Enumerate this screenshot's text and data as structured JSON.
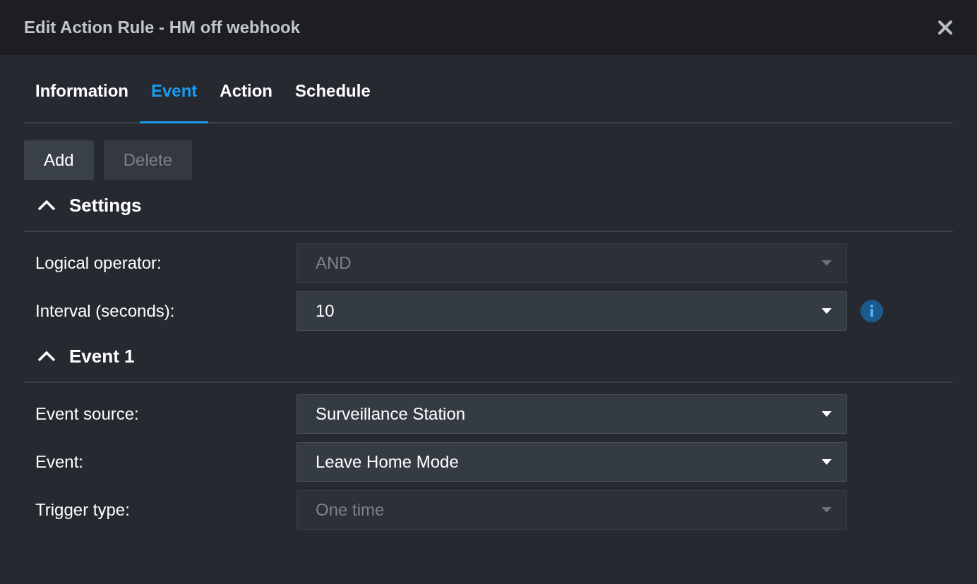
{
  "window": {
    "title": "Edit Action Rule - HM off webhook"
  },
  "tabs": [
    {
      "label": "Information",
      "selected": false
    },
    {
      "label": "Event",
      "selected": true
    },
    {
      "label": "Action",
      "selected": false
    },
    {
      "label": "Schedule",
      "selected": false
    }
  ],
  "buttons": [
    {
      "label": "Add",
      "disabled": false
    },
    {
      "label": "Delete",
      "disabled": true
    }
  ],
  "sections": [
    {
      "title": "Settings",
      "expanded": true,
      "fields": [
        {
          "label": "Logical operator:",
          "value": "AND",
          "disabled": true,
          "info": false
        },
        {
          "label": "Interval (seconds):",
          "value": "10",
          "disabled": false,
          "info": true
        }
      ]
    },
    {
      "title": "Event 1",
      "expanded": true,
      "fields": [
        {
          "label": "Event source:",
          "value": "Surveillance Station",
          "disabled": false,
          "info": false
        },
        {
          "label": "Event:",
          "value": "Leave Home Mode",
          "disabled": false,
          "info": false
        },
        {
          "label": "Trigger type:",
          "value": "One time",
          "disabled": true,
          "info": false
        }
      ]
    }
  ]
}
